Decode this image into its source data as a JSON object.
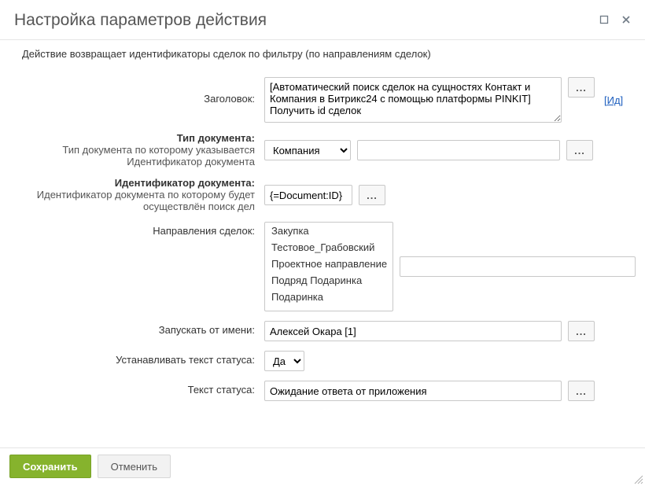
{
  "window": {
    "title": "Настройка параметров действия"
  },
  "description": "Действие возвращает идентификаторы сделок по фильтру (по направлениям сделок)",
  "labels": {
    "title_field": "Заголовок:",
    "doc_type_bold": "Тип документа:",
    "doc_type_sub": "Тип документа по которому указывается Идентификатор документа",
    "doc_id_bold": "Идентификатор документа:",
    "doc_id_sub": "Идентификатор документа по которому будет осуществлён поиск дел",
    "directions": "Направления сделок:",
    "run_as": "Запускать от имени:",
    "set_status": "Устанавливать текст статуса:",
    "status_text": "Текст статуса:"
  },
  "values": {
    "title_text": "[Автоматический поиск сделок на сущностях Контакт и Компания в Битрикс24 с помощью платформы PINKIT] Получить id сделок",
    "id_link": "[Ид]",
    "doc_type_selected": "Компания",
    "doc_type_extra": "",
    "doc_id": "{=Document:ID}",
    "dir_extra": "",
    "run_as": "Алексей Окара [1]",
    "set_status_selected": "Да",
    "status_text": "Ожидание ответа от приложения"
  },
  "options": {
    "doc_type": [
      "Компания"
    ],
    "directions": [
      "Закупка",
      "Тестовое_Грабовский",
      "Проектное направление",
      "Подряд Подаринка",
      "Подаринка"
    ],
    "set_status": [
      "Да"
    ]
  },
  "buttons": {
    "dots": "...",
    "save": "Сохранить",
    "cancel": "Отменить"
  }
}
